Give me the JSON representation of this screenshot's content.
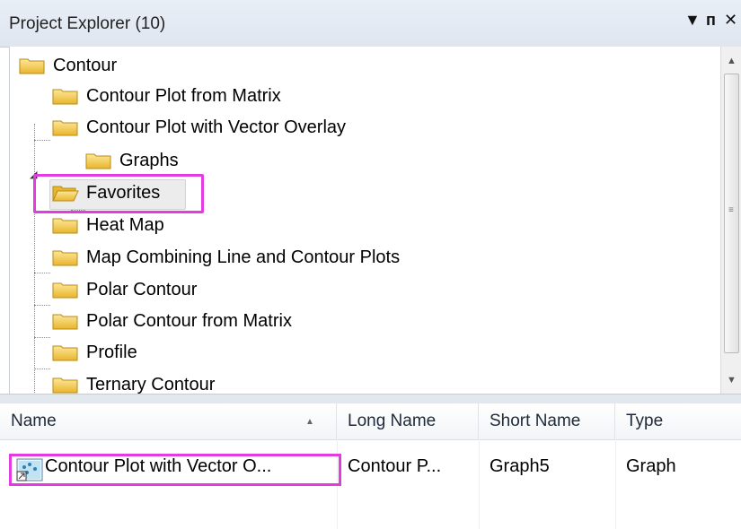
{
  "panel": {
    "title": "Project Explorer (10)",
    "buttons": {
      "dropdown": "▼",
      "pin": "ᴨ",
      "close": "✕"
    }
  },
  "tree": {
    "root": "Contour",
    "items": [
      "Contour Plot from Matrix",
      "Contour Plot with Vector Overlay",
      "Graphs",
      "Favorites",
      "Heat Map",
      "Map Combining Line and Contour Plots",
      "Polar Contour",
      "Polar Contour from Matrix",
      "Profile",
      "Ternary Contour"
    ]
  },
  "list": {
    "columns": [
      "Name",
      "Long Name",
      "Short Name",
      "Type"
    ],
    "rows": [
      {
        "name": "Contour Plot with Vector O...",
        "long_name": "Contour P...",
        "short_name": "Graph5",
        "type": "Graph"
      }
    ]
  },
  "colors": {
    "highlight": "#e23be0",
    "folder": "#f3c93f"
  },
  "icons": {
    "folder": "folder-icon",
    "folder_open": "folder-open-icon",
    "graph": "graph-icon"
  }
}
